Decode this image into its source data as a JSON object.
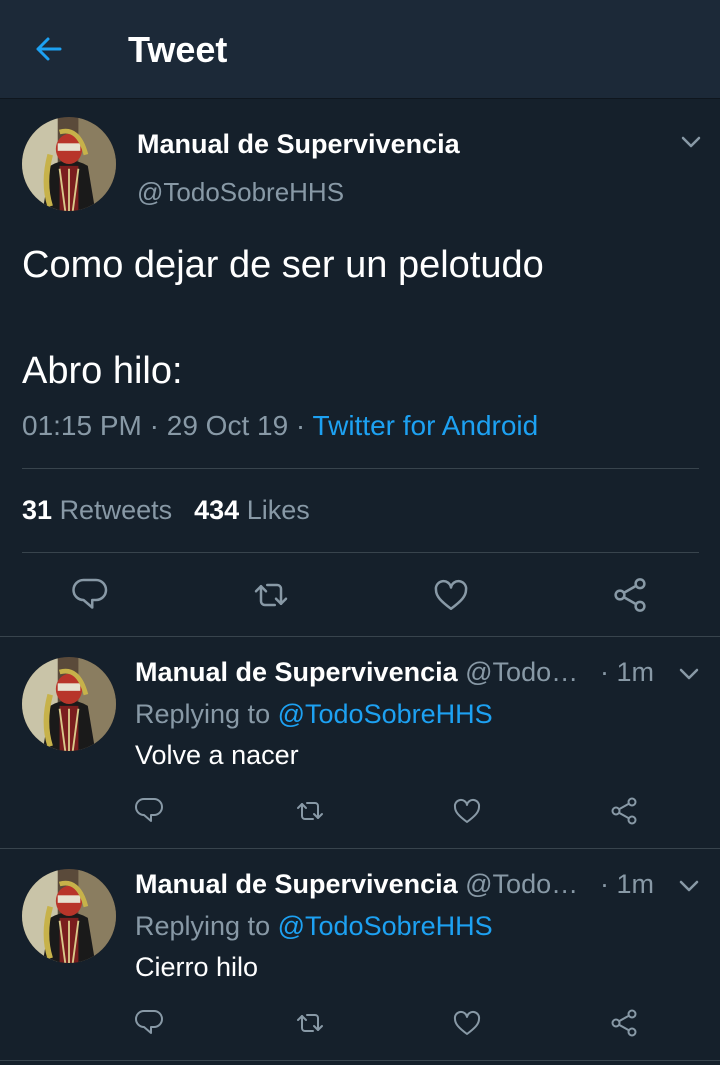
{
  "header": {
    "title": "Tweet",
    "back_icon": "arrow-left-icon"
  },
  "colors": {
    "background": "#15202b",
    "header": "#1c2938",
    "accent": "#1da1f2",
    "secondary_text": "#8899a6",
    "divider": "#38444d"
  },
  "main_tweet": {
    "author_name": "Manual de Supervivencia",
    "author_handle": "@TodoSobreHHS",
    "text": "Como dejar de ser un pelotudo\n\nAbro hilo:",
    "time": "01:15 PM",
    "date": "29 Oct 19",
    "source": "Twitter for Android",
    "retweets_count": "31",
    "retweets_label": "Retweets",
    "likes_count": "434",
    "likes_label": "Likes"
  },
  "replies": [
    {
      "author_name": "Manual de Supervivencia",
      "author_handle": "@Todo…",
      "time": "1m",
      "replying_label": "Replying to",
      "replying_to": "@TodoSobreHHS",
      "text": "Volve a nacer"
    },
    {
      "author_name": "Manual de Supervivencia",
      "author_handle": "@Todo…",
      "time": "1m",
      "replying_label": "Replying to",
      "replying_to": "@TodoSobreHHS",
      "text": "Cierro hilo"
    }
  ],
  "actions": [
    "reply-icon",
    "retweet-icon",
    "like-icon",
    "share-icon"
  ]
}
